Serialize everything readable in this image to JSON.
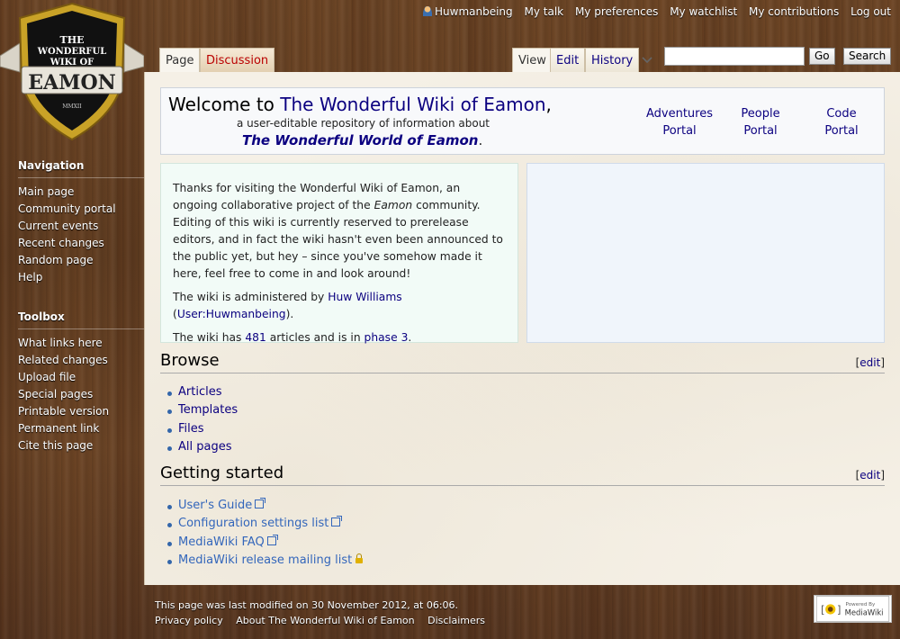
{
  "personal": {
    "username": "Huwmanbeing",
    "items": [
      "My talk",
      "My preferences",
      "My watchlist",
      "My contributions",
      "Log out"
    ]
  },
  "logo": {
    "line1": "THE",
    "line2": "WONDERFUL",
    "line3": "WIKI OF",
    "big": "EAMON",
    "year": "MMXII"
  },
  "navigation": {
    "heading": "Navigation",
    "items": [
      "Main page",
      "Community portal",
      "Current events",
      "Recent changes",
      "Random page",
      "Help"
    ]
  },
  "toolbox": {
    "heading": "Toolbox",
    "items": [
      "What links here",
      "Related changes",
      "Upload file",
      "Special pages",
      "Printable version",
      "Permanent link",
      "Cite this page"
    ]
  },
  "tabs": {
    "page": "Page",
    "discussion": "Discussion",
    "view": "View",
    "edit": "Edit",
    "history": "History"
  },
  "search": {
    "value": "",
    "go": "Go",
    "search": "Search"
  },
  "welcome": {
    "prefix": "Welcome to ",
    "wiki_link": "The Wonderful Wiki of Eamon",
    "suffix": ",",
    "subtitle": "a user-editable repository of information about",
    "world": "The Wonderful World of Eamon",
    "world_suffix": ".",
    "portals": [
      {
        "line1": "Adventures",
        "line2": "Portal"
      },
      {
        "line1": "People",
        "line2": "Portal"
      },
      {
        "line1": "Code",
        "line2": "Portal"
      }
    ]
  },
  "intro": {
    "p1_a": "Thanks for visiting the Wonderful Wiki of Eamon, an ongoing collaborative project of the ",
    "p1_em": "Eamon",
    "p1_b": " community. Editing of this wiki is currently reserved to prerelease editors, and in fact the wiki hasn't even been announced to the public yet, but hey – since you've somehow made it here, feel free to come in and look around!",
    "p2_a": "The wiki is administered by ",
    "p2_link1": "Huw Williams",
    "p2_mid": " (",
    "p2_link2": "User:Huwmanbeing",
    "p2_end": ").",
    "p3_a": "The wiki has ",
    "p3_count": "481",
    "p3_mid": " articles and is in ",
    "p3_link": "phase 3",
    "p3_end": "."
  },
  "browse": {
    "title": "Browse",
    "edit": "edit",
    "items": [
      "Articles",
      "Templates",
      "Files",
      "All pages"
    ]
  },
  "getting_started": {
    "title": "Getting started",
    "edit": "edit",
    "items": [
      "User's Guide",
      "Configuration settings list",
      "MediaWiki FAQ",
      "MediaWiki release mailing list"
    ]
  },
  "footer": {
    "modified": "This page was last modified on 30 November 2012, at 06:06.",
    "links": [
      "Privacy policy",
      "About The Wonderful Wiki of Eamon",
      "Disclaimers"
    ],
    "powered_small": "Powered By",
    "powered_big": "MediaWiki"
  }
}
